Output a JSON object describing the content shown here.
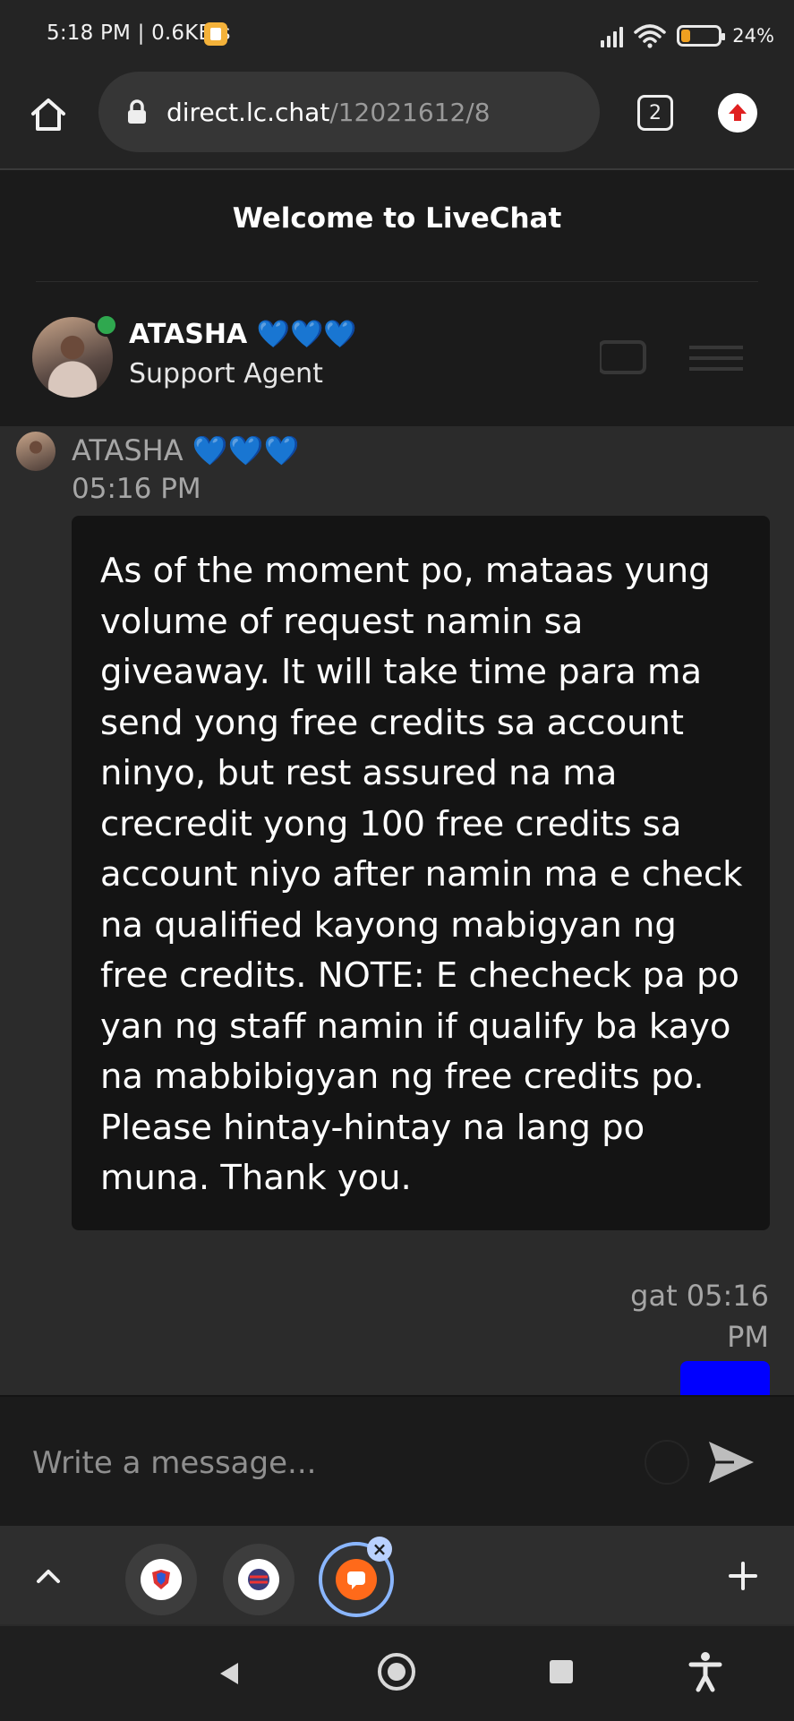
{
  "status_bar": {
    "time": "5:18 PM",
    "network_speed": "0.6KB/s",
    "battery_percent": "24",
    "battery_level": 0.24,
    "signal_bars": 4,
    "colors": {
      "battery_fill": "#f0a020",
      "notification": "#f4b23a"
    }
  },
  "browser": {
    "url_host": "direct.lc.chat",
    "url_path": "/12021612/8",
    "tab_count": "2",
    "icons": [
      "home-icon",
      "lock-icon",
      "tab-switcher-icon",
      "update-arrow-icon"
    ]
  },
  "chat": {
    "title": "Welcome to LiveChat",
    "agent": {
      "name": "ATASHA 💙💙💙",
      "role": "Support Agent",
      "status": "online"
    },
    "messages": [
      {
        "author": "ATASHA 💙💙💙",
        "time": "05:16 PM",
        "text": "As of the moment po, mataas yung volume of request namin sa giveaway. It will take time para ma send yong free credits sa account ninyo, but rest assured na ma crecredit yong 100 free credits sa account niyo after namin ma e check na qualified kayong mabigyan ng free credits. NOTE: E checheck pa po yan ng staff namin if qualify ba kayo na mabbibigyan ng free credits po. Please hintay-hintay na lang po muna. Thank you."
      },
      {
        "author": "gat",
        "time": "05:16 PM",
        "meta_line1": "gat 05:16",
        "meta_line2": "PM",
        "bubble_color": "#0000ff"
      }
    ],
    "composer": {
      "placeholder": "Write a message..."
    }
  },
  "bubble_bar": {
    "icons": [
      "chevron-up-icon",
      "tab-bubble-icon",
      "tab-bubble-icon",
      "livechat-bubble-icon",
      "close-icon",
      "plus-icon"
    ],
    "active_color": "#8ab6ff"
  },
  "system_nav": {
    "icons": [
      "back-icon",
      "home-icon",
      "recents-icon",
      "accessibility-icon"
    ]
  }
}
